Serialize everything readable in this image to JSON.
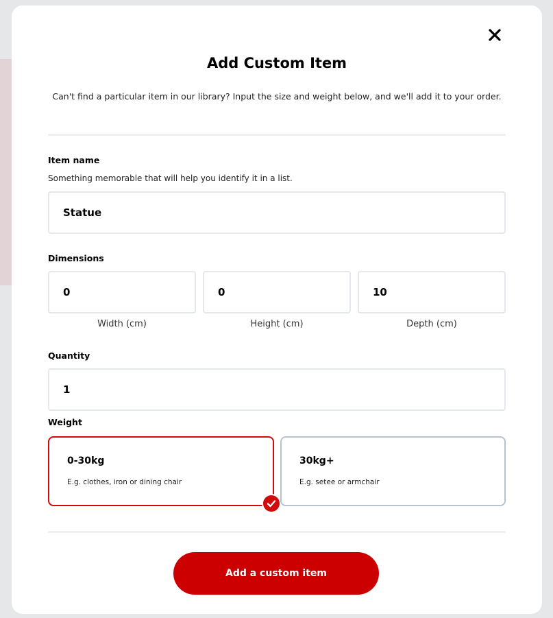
{
  "modal": {
    "title": "Add Custom Item",
    "subtitle": "Can't find a particular item in our library? Input the size and weight below, and we'll add it to your order."
  },
  "item_name": {
    "label": "Item name",
    "hint": "Something memorable that will help you identify it in a list.",
    "value": "Statue"
  },
  "dimensions": {
    "label": "Dimensions",
    "width": {
      "value": "0",
      "label": "Width (cm)"
    },
    "height": {
      "value": "0",
      "label": "Height (cm)"
    },
    "depth": {
      "value": "10",
      "label": "Depth (cm)"
    }
  },
  "quantity": {
    "label": "Quantity",
    "value": "1"
  },
  "weight": {
    "label": "Weight",
    "options": [
      {
        "title": "0-30kg",
        "description": "E.g. clothes, iron or dining chair",
        "selected": true
      },
      {
        "title": "30kg+",
        "description": "E.g. setee or armchair",
        "selected": false
      }
    ]
  },
  "submit": {
    "label": "Add a custom item"
  },
  "icons": {
    "close": "close-icon",
    "check": "check-icon"
  },
  "colors": {
    "accent": "#cc0000",
    "selected_border": "#d10a0a",
    "unselected_border": "#b9c1ca",
    "field_border": "#e4e7ec"
  }
}
